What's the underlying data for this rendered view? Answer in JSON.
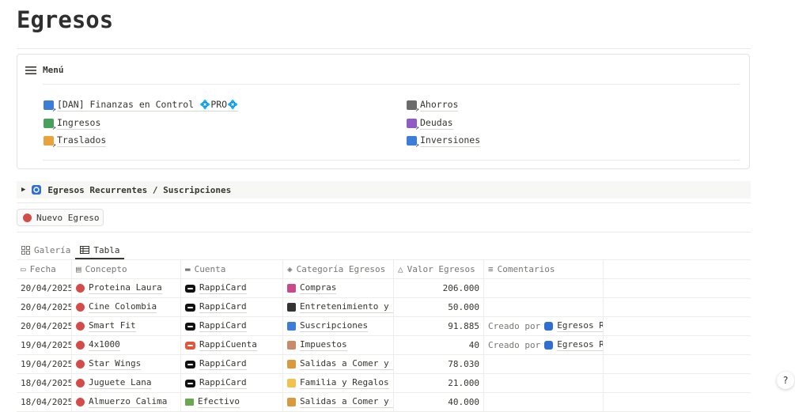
{
  "page": {
    "title": "Egresos"
  },
  "menu": {
    "title": "Menú",
    "links_left": [
      {
        "label": "[DAN] Finanzas en Control 💠PRO💠",
        "color": "#3b7dd8"
      },
      {
        "label": "Ingresos",
        "color": "#4aa05a"
      },
      {
        "label": "Traslados",
        "color": "#e8a33d"
      }
    ],
    "links_right": [
      {
        "label": "Ahorros",
        "color": "#6b6b6b"
      },
      {
        "label": "Deudas",
        "color": "#8e5cc2"
      },
      {
        "label": "Inversiones",
        "color": "#3b7dd8"
      }
    ]
  },
  "toggle": {
    "label": "Egresos Recurrentes / Suscripciones"
  },
  "button": {
    "label": "Nuevo Egreso"
  },
  "views": [
    {
      "label": "Galería",
      "active": false
    },
    {
      "label": "Tabla",
      "active": true
    }
  ],
  "table": {
    "headers": [
      "Fecha",
      "Concepto",
      "Cuenta",
      "Categoría Egresos",
      "Valor Egresos",
      "Comentarios"
    ],
    "rows": [
      {
        "fecha": "20/04/2025",
        "concepto": "Proteina Laura",
        "cuenta": "RappiCard",
        "cuenta_icon": "card",
        "categoria": "Compras",
        "cat_icon": "shopping-bags-icon",
        "cat_color": "#c94a8a",
        "valor": "206.000",
        "comentario_pre": "",
        "comentario_link": ""
      },
      {
        "fecha": "20/04/2025",
        "concepto": "Cine Colombia",
        "cuenta": "RappiCard",
        "cuenta_icon": "card",
        "categoria": "Entretenimiento y Ocio",
        "cat_icon": "bomb-icon",
        "cat_color": "#333333",
        "valor": "50.000",
        "comentario_pre": "",
        "comentario_link": ""
      },
      {
        "fecha": "20/04/2025",
        "concepto": "Smart Fit",
        "cuenta": "RappiCard",
        "cuenta_icon": "card",
        "categoria": "Suscripciones",
        "cat_icon": "tv-icon",
        "cat_color": "#3b7dd8",
        "valor": "91.885",
        "comentario_pre": "Creado por",
        "comentario_link": "Egresos Recurrentes"
      },
      {
        "fecha": "19/04/2025",
        "concepto": "4x1000",
        "cuenta": "RappiCuenta",
        "cuenta_icon": "card-red",
        "categoria": "Impuestos",
        "cat_icon": "receipt-icon",
        "cat_color": "#c98a6a",
        "valor": "40",
        "comentario_pre": "Creado por",
        "comentario_link": "Egresos Recurrentes"
      },
      {
        "fecha": "19/04/2025",
        "concepto": "Star Wings",
        "cuenta": "RappiCard",
        "cuenta_icon": "card",
        "categoria": "Salidas a Comer y Beber",
        "cat_icon": "burger-icon",
        "cat_color": "#d89a3c",
        "valor": "78.030",
        "comentario_pre": "",
        "comentario_link": ""
      },
      {
        "fecha": "18/04/2025",
        "concepto": "Juguete Lana",
        "cuenta": "RappiCard",
        "cuenta_icon": "card",
        "categoria": "Familia y Regalos",
        "cat_icon": "heart-icon",
        "cat_color": "#f2c14e",
        "valor": "21.000",
        "comentario_pre": "",
        "comentario_link": ""
      },
      {
        "fecha": "18/04/2025",
        "concepto": "Almuerzo Calima",
        "cuenta": "Efectivo",
        "cuenta_icon": "cash",
        "categoria": "Salidas a Comer y Beber",
        "cat_icon": "burger-icon",
        "cat_color": "#d89a3c",
        "valor": "40.000",
        "comentario_pre": "",
        "comentario_link": ""
      }
    ]
  },
  "fab": {
    "label": "?"
  }
}
